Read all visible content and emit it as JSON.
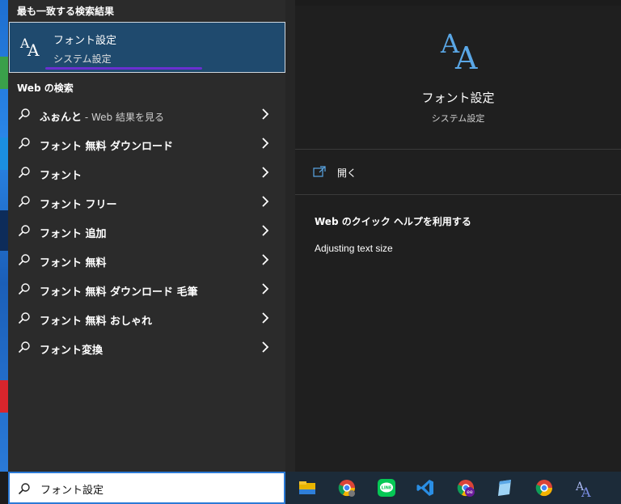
{
  "best_match": {
    "section_title": "最も一致する検索結果",
    "title": "フォント設定",
    "subtitle": "システム設定"
  },
  "web_section": {
    "title": "Web の検索",
    "items": [
      {
        "label": "ふぉんと",
        "suffix": " - Web 結果を見る"
      },
      {
        "label": "フォント 無料 ダウンロード",
        "suffix": ""
      },
      {
        "label": "フォント",
        "suffix": ""
      },
      {
        "label": "フォント フリー",
        "suffix": ""
      },
      {
        "label": "フォント 追加",
        "suffix": ""
      },
      {
        "label": "フォント 無料",
        "suffix": ""
      },
      {
        "label": "フォント 無料 ダウンロード 毛筆",
        "suffix": ""
      },
      {
        "label": "フォント 無料 おしゃれ",
        "suffix": ""
      },
      {
        "label": "フォント変換",
        "suffix": ""
      }
    ]
  },
  "detail": {
    "title": "フォント設定",
    "subtitle": "システム設定",
    "open_label": "開く",
    "help_title": "Web のクイック ヘルプを利用する",
    "help_link": "Adjusting text size"
  },
  "search": {
    "value": "フォント設定"
  },
  "taskbar": {
    "icons": [
      "file-explorer-icon",
      "chrome-user-icon",
      "line-icon",
      "vscode-icon",
      "chrome-ee-icon",
      "notepad-icon",
      "chrome-icon",
      "font-app-icon"
    ]
  },
  "colors": {
    "accent": "#1f4a6e",
    "underline": "#6a2fd0",
    "icon_blue": "#5aa7e6"
  }
}
